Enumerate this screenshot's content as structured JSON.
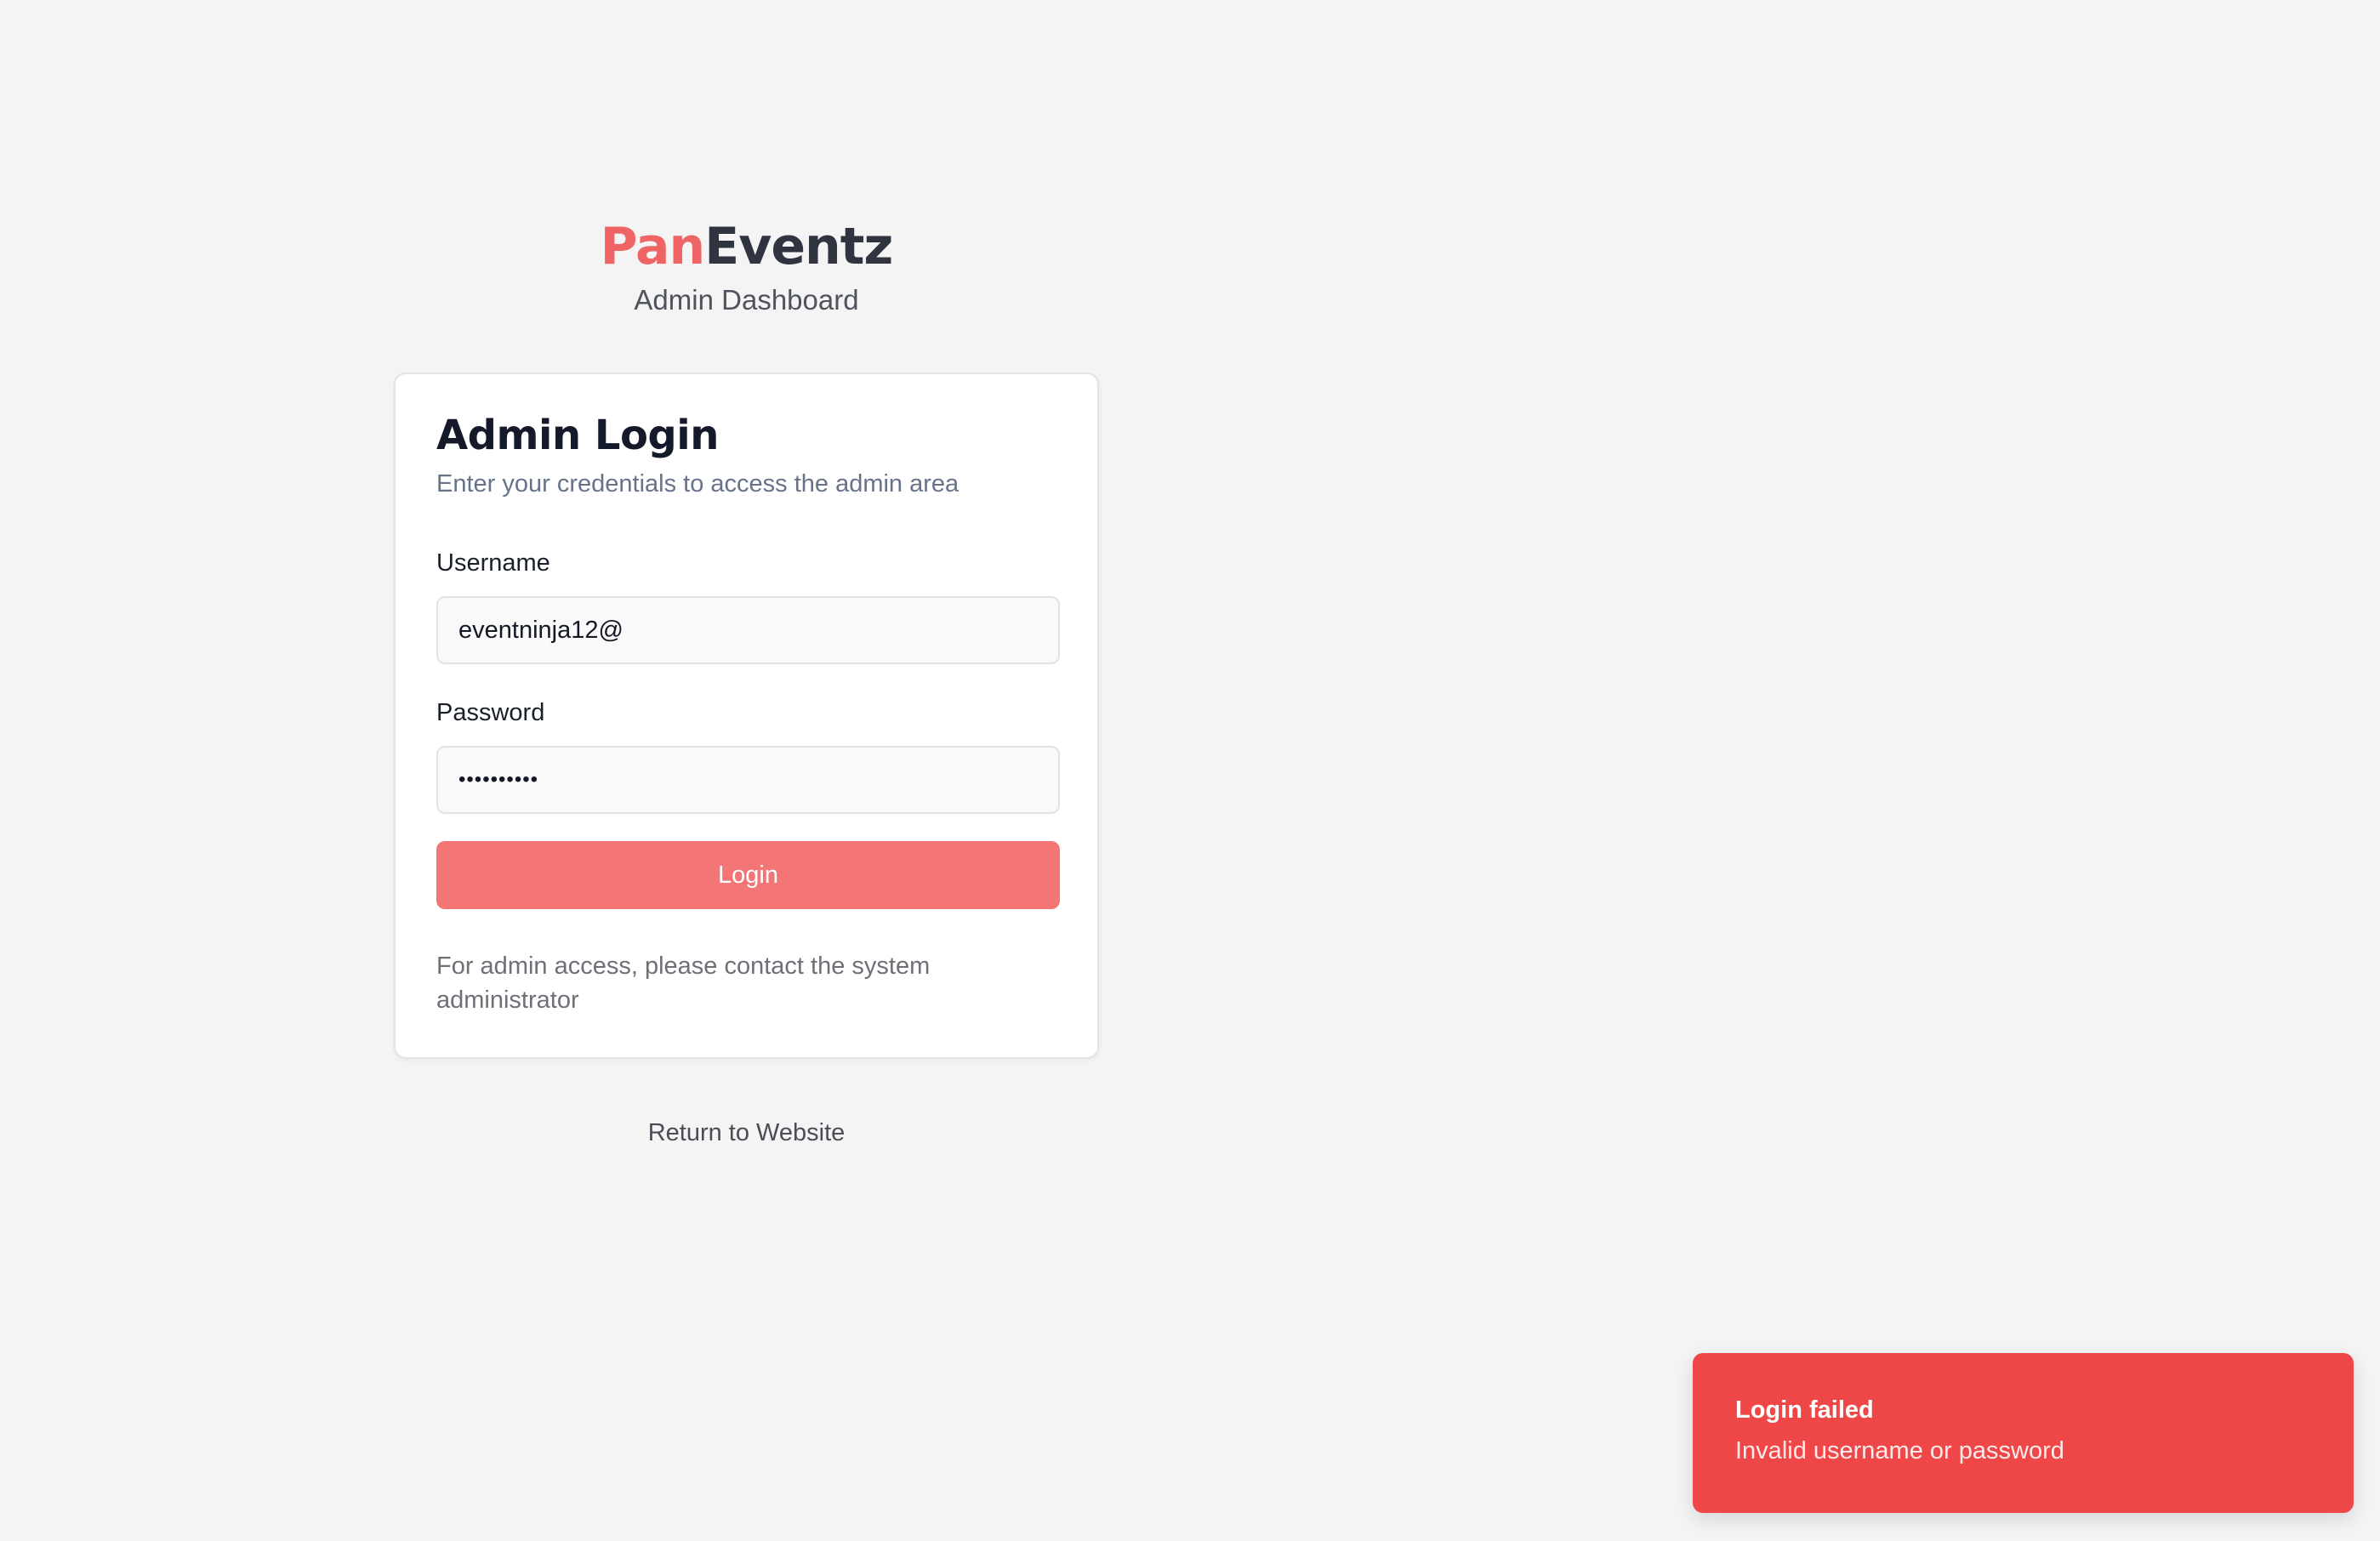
{
  "brand": {
    "name_part1": "Pan",
    "name_part2": "Eventz",
    "subtitle": "Admin Dashboard",
    "accent_color": "#ef6565"
  },
  "login_card": {
    "title": "Admin Login",
    "description": "Enter your credentials to access the admin area",
    "username": {
      "label": "Username",
      "value": "eventninja12@"
    },
    "password": {
      "label": "Password",
      "value": "••••••••••"
    },
    "login_button_label": "Login",
    "note": "For admin access, please contact the system administrator"
  },
  "return_link_label": "Return to Website",
  "toast": {
    "title": "Login failed",
    "message": "Invalid username or password",
    "color": "#ef4747"
  }
}
